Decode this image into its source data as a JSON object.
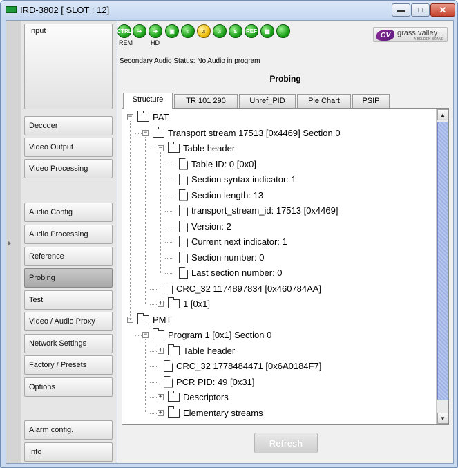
{
  "window": {
    "title": "IRD-3802 [ SLOT : 12]"
  },
  "sidebar": {
    "items": [
      {
        "label": "Input"
      },
      {
        "label": "Decoder"
      },
      {
        "label": "Video Output"
      },
      {
        "label": "Video Processing"
      },
      {
        "label": "Audio Config"
      },
      {
        "label": "Audio Processing"
      },
      {
        "label": "Reference"
      },
      {
        "label": "Probing"
      },
      {
        "label": "Test"
      },
      {
        "label": "Video / Audio Proxy"
      },
      {
        "label": "Network Settings"
      },
      {
        "label": "Factory / Presets"
      },
      {
        "label": "Options"
      },
      {
        "label": "Alarm config."
      },
      {
        "label": "Info"
      }
    ],
    "active": "Probing"
  },
  "status_icons": {
    "items": [
      {
        "icon": "ctrl-status-icon",
        "text": "CTRL",
        "label": "REM"
      },
      {
        "icon": "input-arrow-status-icon",
        "text": "",
        "label": ""
      },
      {
        "icon": "output-arrow-status-icon",
        "text": "",
        "label": "HD"
      },
      {
        "icon": "lock-status-icon",
        "text": "",
        "label": ""
      },
      {
        "icon": "audio-status-icon",
        "text": "",
        "label": ""
      },
      {
        "icon": "audio-warning-status-icon",
        "text": "",
        "label": ""
      },
      {
        "icon": "audio-lock-status-icon",
        "text": "",
        "label": ""
      },
      {
        "icon": "curve-status-icon",
        "text": "",
        "label": ""
      },
      {
        "icon": "ref-status-icon",
        "text": "REF",
        "label": ""
      },
      {
        "icon": "monitor-status-icon",
        "text": "",
        "label": ""
      },
      {
        "icon": "ok-status-icon",
        "text": "",
        "label": ""
      }
    ]
  },
  "brand": {
    "name": "grass valley",
    "sub": "A BELDEN BRAND"
  },
  "status_text": "Secondary Audio Status: No Audio in program",
  "panel_title": "Probing",
  "tabs": [
    {
      "label": "Structure"
    },
    {
      "label": "TR 101 290"
    },
    {
      "label": "Unref_PID"
    },
    {
      "label": "Pie Chart"
    },
    {
      "label": "PSIP"
    }
  ],
  "active_tab": "Structure",
  "tree": [
    {
      "label": "PAT",
      "expander": "minus",
      "kind": "folder"
    },
    {
      "label": "Transport stream 17513 [0x4469] Section 0",
      "expander": "minus",
      "kind": "folder"
    },
    {
      "label": "Table header",
      "expander": "minus",
      "kind": "folder"
    },
    {
      "label": "Table ID: 0 [0x0]",
      "expander": "",
      "kind": "doc"
    },
    {
      "label": "Section syntax indicator: 1",
      "expander": "",
      "kind": "doc"
    },
    {
      "label": "Section length: 13",
      "expander": "",
      "kind": "doc"
    },
    {
      "label": "transport_stream_id: 17513 [0x4469]",
      "expander": "",
      "kind": "doc"
    },
    {
      "label": "Version: 2",
      "expander": "",
      "kind": "doc"
    },
    {
      "label": "Current next indicator: 1",
      "expander": "",
      "kind": "doc"
    },
    {
      "label": "Section number: 0",
      "expander": "",
      "kind": "doc"
    },
    {
      "label": "Last section number: 0",
      "expander": "",
      "kind": "doc"
    },
    {
      "label": "CRC_32 1174897834 [0x460784AA]",
      "expander": "",
      "kind": "doc"
    },
    {
      "label": "1 [0x1]",
      "expander": "plus",
      "kind": "folder"
    },
    {
      "label": "PMT",
      "expander": "minus",
      "kind": "folder"
    },
    {
      "label": "Program 1 [0x1] Section 0",
      "expander": "minus",
      "kind": "folder"
    },
    {
      "label": "Table header",
      "expander": "plus",
      "kind": "folder"
    },
    {
      "label": "CRC_32 1778484471 [0x6A0184F7]",
      "expander": "",
      "kind": "doc"
    },
    {
      "label": "PCR PID: 49 [0x31]",
      "expander": "",
      "kind": "doc"
    },
    {
      "label": "Descriptors",
      "expander": "plus",
      "kind": "folder"
    },
    {
      "label": "Elementary streams",
      "expander": "plus",
      "kind": "folder"
    }
  ],
  "refresh_label": "Refresh"
}
